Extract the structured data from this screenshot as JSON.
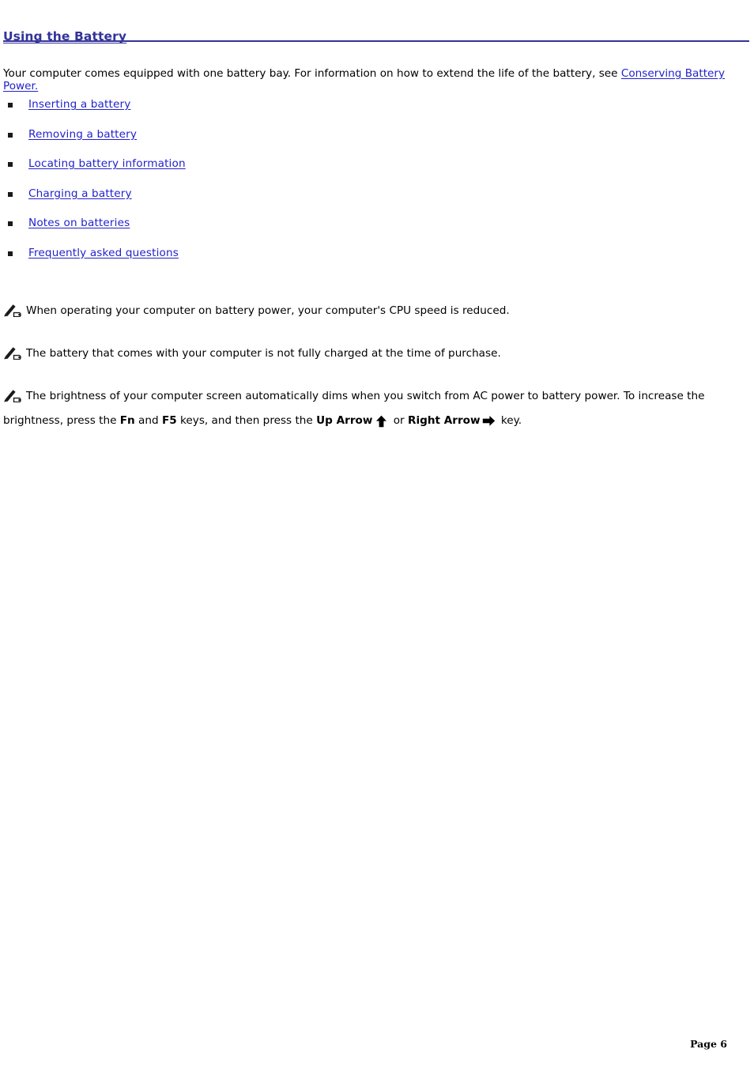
{
  "document": {
    "title": "Using the Battery",
    "intro": {
      "text_before_link": "Your computer comes equipped with one battery bay. For information on how to extend the life of the battery, see ",
      "link_label": "Conserving Battery Power."
    },
    "topic_links": [
      {
        "label": "Inserting a battery"
      },
      {
        "label": "Removing a battery"
      },
      {
        "label": "Locating battery information"
      },
      {
        "label": "Charging a battery"
      },
      {
        "label": "Notes on batteries"
      },
      {
        "label": "Frequently asked questions"
      }
    ],
    "notes": [
      {
        "icon": "note-pencil-icon",
        "text": "When operating your computer on battery power, your computer's CPU speed is reduced."
      },
      {
        "icon": "note-pencil-icon",
        "text": "The battery that comes with your computer is not fully charged at the time of purchase."
      },
      {
        "icon": "note-pencil-icon",
        "segment_1": "The brightness of your computer screen automatically dims when you switch from AC power to battery power. To increase the brightness, press the ",
        "key_1": "Fn",
        "segment_2": " and ",
        "key_2": "F5",
        "segment_3": " keys, and then press the ",
        "key_3": "Up Arrow",
        "arrow_1": "up-arrow-icon",
        "segment_4": " or ",
        "key_4": "Right Arrow",
        "arrow_2": "right-arrow-icon",
        "segment_5": " key."
      }
    ],
    "footer": {
      "page_label": "Page 6"
    },
    "colors": {
      "heading": "#333399",
      "link": "#2222CC",
      "text": "#000000",
      "background": "#FFFFFF"
    }
  }
}
